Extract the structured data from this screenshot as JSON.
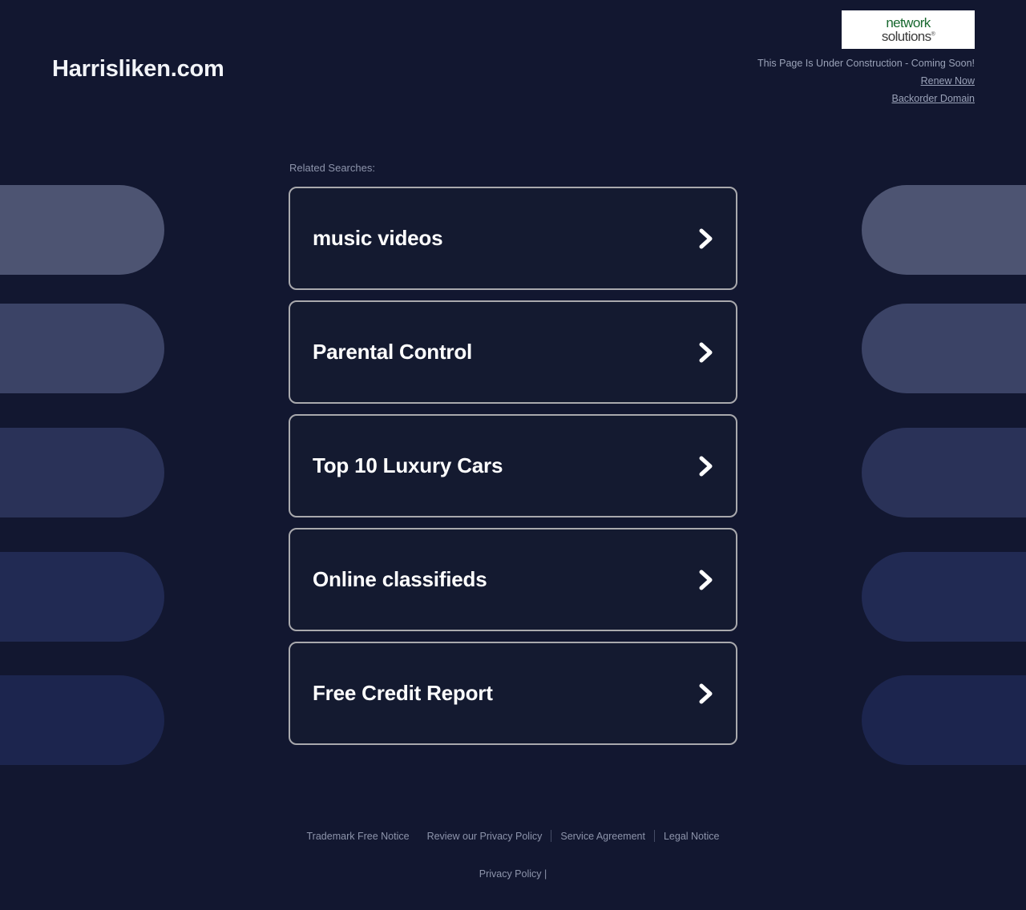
{
  "header": {
    "domain_title": "Harrisliken.com",
    "logo": {
      "line1": "network",
      "line2": "solutions",
      "trademark": "®"
    },
    "construction_notice": "This Page Is Under Construction - Coming Soon!",
    "renew_link": "Renew Now",
    "backorder_link": "Backorder Domain"
  },
  "main": {
    "related_label": "Related Searches:",
    "cards": [
      {
        "label": "music videos",
        "icon": "chevron-right-icon"
      },
      {
        "label": "Parental Control",
        "icon": "chevron-right-icon"
      },
      {
        "label": "Top 10 Luxury Cars",
        "icon": "chevron-right-icon"
      },
      {
        "label": "Online classifieds",
        "icon": "chevron-right-icon"
      },
      {
        "label": "Free Credit Report",
        "icon": "chevron-right-icon"
      }
    ]
  },
  "footer": {
    "links": [
      "Trademark Free Notice",
      "Review our Privacy Policy",
      "Service Agreement",
      "Legal Notice"
    ],
    "bottom_text": "Privacy Policy |",
    "bottom_link": "Privacy Policy"
  },
  "colors": {
    "page_background": "#121730",
    "card_border": "#a9a9ad",
    "card_fill": "#141a30",
    "card_text": "#ffffff",
    "muted_text": "#8d94ab",
    "logo_green": "#18682f",
    "pill_1": "#4d5472",
    "pill_2": "#3b4366",
    "pill_3": "#2a3258",
    "pill_4": "#212a53",
    "pill_5": "#1c254e"
  }
}
